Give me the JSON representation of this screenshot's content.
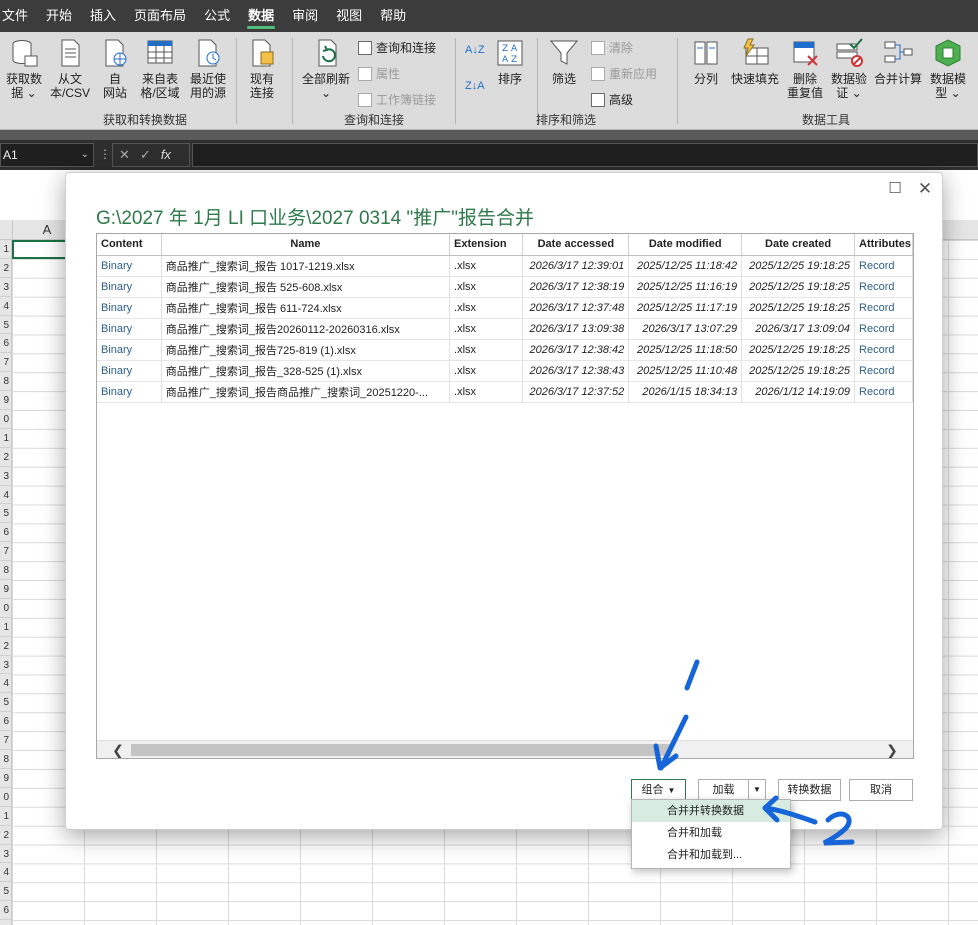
{
  "ribbon_tabs": [
    "文件",
    "开始",
    "插入",
    "页面布局",
    "公式",
    "数据",
    "审阅",
    "视图",
    "帮助"
  ],
  "active_tab": "数据",
  "groups": {
    "get_transform": {
      "name": "获取和转换数据",
      "buttons": [
        {
          "l1": "获取数",
          "l2": "据 ⌄"
        },
        {
          "l1": "从文",
          "l2": "本/CSV"
        },
        {
          "l1": "自",
          "l2": "网站"
        },
        {
          "l1": "来自表",
          "l2": "格/区域"
        },
        {
          "l1": "最近使",
          "l2": "用的源"
        },
        {
          "l1": "现有",
          "l2": "连接"
        }
      ]
    },
    "queries": {
      "name": "查询和连接",
      "refresh": {
        "l1": "全部刷新",
        "l2": "⌄"
      },
      "items": [
        "查询和连接",
        "属性",
        "工作簿链接"
      ]
    },
    "sort_filter": {
      "name": "排序和筛选",
      "sort": "排序",
      "filter": "筛选",
      "items": [
        "清除",
        "重新应用",
        "高级"
      ]
    },
    "data_tools": {
      "name": "数据工具",
      "buttons": [
        {
          "l1": "分列",
          "l2": ""
        },
        {
          "l1": "快速填充",
          "l2": ""
        },
        {
          "l1": "删除",
          "l2": "重复值"
        },
        {
          "l1": "数据验",
          "l2": "证 ⌄"
        },
        {
          "l1": "合并计算",
          "l2": ""
        },
        {
          "l1": "数据模",
          "l2": "型 ⌄"
        }
      ]
    }
  },
  "name_box": "A1",
  "fx_label": "fx",
  "column_header": "A",
  "row_numbers": [
    "1",
    "2",
    "3",
    "4",
    "5",
    "6",
    "7",
    "8",
    "9",
    "0",
    "1",
    "2",
    "3",
    "4",
    "5",
    "6",
    "7",
    "8",
    "9",
    "0",
    "1",
    "2",
    "3",
    "4",
    "5",
    "6",
    "7",
    "8",
    "9",
    "0",
    "1",
    "2",
    "3",
    "4",
    "5",
    "6"
  ],
  "dialog": {
    "title": "G:\\2027 年 1月 LI 口业务\\2027 0314 \"推广\"报告合并",
    "columns": [
      "Content",
      "Name",
      "Extension",
      "Date accessed",
      "Date modified",
      "Date created",
      "Attributes"
    ],
    "rows": [
      [
        "Binary",
        "商品推广_搜索词_报告 1017-1219.xlsx",
        ".xlsx",
        "2026/3/17 12:39:01",
        "2025/12/25 11:18:42",
        "2025/12/25 19:18:25",
        "Record"
      ],
      [
        "Binary",
        "商品推广_搜索词_报告 525-608.xlsx",
        ".xlsx",
        "2026/3/17 12:38:19",
        "2025/12/25 11:16:19",
        "2025/12/25 19:18:25",
        "Record"
      ],
      [
        "Binary",
        "商品推广_搜索词_报告 611-724.xlsx",
        ".xlsx",
        "2026/3/17 12:37:48",
        "2025/12/25 11:17:19",
        "2025/12/25 19:18:25",
        "Record"
      ],
      [
        "Binary",
        "商品推广_搜索词_报告20260112-20260316.xlsx",
        ".xlsx",
        "2026/3/17 13:09:38",
        "2026/3/17 13:07:29",
        "2026/3/17 13:09:04",
        "Record"
      ],
      [
        "Binary",
        "商品推广_搜索词_报告725-819 (1).xlsx",
        ".xlsx",
        "2026/3/17 12:38:42",
        "2025/12/25 11:18:50",
        "2025/12/25 19:18:25",
        "Record"
      ],
      [
        "Binary",
        "商品推广_搜索词_报告_328-525 (1).xlsx",
        ".xlsx",
        "2026/3/17 12:38:43",
        "2025/12/25 11:10:48",
        "2025/12/25 19:18:25",
        "Record"
      ],
      [
        "Binary",
        "商品推广_搜索词_报告商品推广_搜索词_20251220-...",
        ".xlsx",
        "2026/3/17 12:37:52",
        "2026/1/15 18:34:13",
        "2026/1/12 14:19:09",
        "Record"
      ]
    ],
    "buttons": {
      "combine": "组合",
      "load": "加载",
      "transform": "转换数据",
      "cancel": "取消"
    },
    "dropdown": [
      "合并并转换数据",
      "合并和加载",
      "合并和加载到..."
    ],
    "dropdown_hover_index": 0
  },
  "annotations": [
    "1",
    "2"
  ],
  "colors": {
    "accent_green": "#2f7a4a",
    "annotation_blue": "#1565d8",
    "ribbon_bg": "#dcdcdc",
    "menubar_bg": "#3c3c3c"
  }
}
